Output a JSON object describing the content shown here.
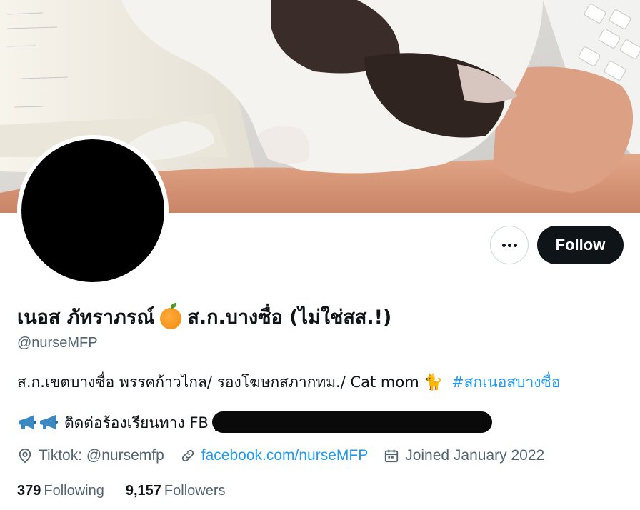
{
  "profile": {
    "display_name_part1": "เนอส ภัทราภรณ์",
    "display_name_part2": "ส.ก.บางซื่อ (ไม่ใช่สส.!)",
    "name_icon": "orange-emoji",
    "handle": "@nurseMFP",
    "bio_text": "ส.ก.เขตบางซื่อ พรรคก้าวไกล/ รองโฆษกสภากทม./ Cat mom",
    "bio_icon": "cat-emoji",
    "bio_hashtag": "#สกเนอสบางซื่อ",
    "contact_prefix": "ติดต่อร้องเรียนทาง FB |",
    "contact_icon": "megaphone-emoji"
  },
  "actions": {
    "more_icon": "more-horizontal-icon",
    "follow_label": "Follow"
  },
  "meta": {
    "location": "Tiktok: @nursemfp",
    "location_icon": "location-pin-icon",
    "website": "facebook.com/nurseMFP",
    "website_icon": "link-icon",
    "joined": "Joined January 2022",
    "joined_icon": "calendar-icon"
  },
  "stats": {
    "following_count": "379",
    "following_label": "Following",
    "followers_count": "9,157",
    "followers_label": "Followers"
  },
  "colors": {
    "link": "#1d9bf0",
    "text_primary": "#0f1419",
    "text_secondary": "#536471",
    "follow_bg": "#0f1419"
  }
}
